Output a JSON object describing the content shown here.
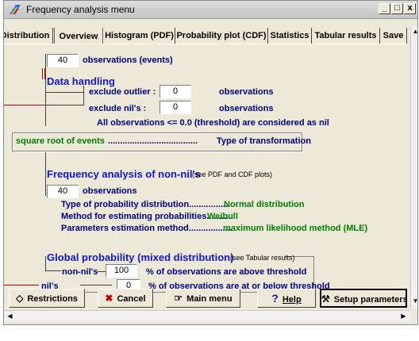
{
  "window": {
    "title": "Frequency analysis menu",
    "minimize": "_",
    "maximize": "□",
    "close": "x"
  },
  "tabs": [
    {
      "label": "Distribution"
    },
    {
      "label": "Overview",
      "active": true
    },
    {
      "label": "Histogram (PDF)"
    },
    {
      "label": "Probability plot (CDF)"
    },
    {
      "label": "Statistics"
    },
    {
      "label": "Tabular results"
    },
    {
      "label": "Save"
    }
  ],
  "overview": {
    "observations_count": "40",
    "observations_label": "observations (events)",
    "data_handling": {
      "heading": "Data handling",
      "exclude_outlier_label": "exclude outlier :",
      "exclude_outlier_value": "0",
      "exclude_outlier_unit": "observations",
      "exclude_nils_label": "exclude nil's :",
      "exclude_nils_value": "0",
      "exclude_nils_unit": "observations",
      "threshold_note": "All observations <= 0.0 (threshold) are considered as nil"
    },
    "transformation": {
      "value": "square root of events",
      "dots": ".....................................",
      "label": "Type of transformation"
    },
    "freq_non_nil": {
      "heading": "Frequency analysis of non-nil's",
      "note": "(see PDF and CDF plots)",
      "observations_value": "40",
      "observations_label": "observations",
      "distribution_label": "Type of probability distribution.................",
      "distribution_value": "Normal distribution",
      "method_label": "Method for estimating probabilities...........",
      "method_value": "Weibull",
      "estimation_label": "Parameters estimation method..................",
      "estimation_value": "maximum likelihood method (MLE)"
    },
    "global_prob": {
      "heading": "Global probability (mixed distribution)",
      "note": "(see Tabular results)",
      "non_nils_label": "non-nil's",
      "non_nils_value": "100",
      "non_nils_text": "% of observations are above threshold",
      "nils_label": "nil's",
      "nils_value": "0",
      "nils_text": "% of observations are at or below threshold"
    }
  },
  "buttons": {
    "restrictions": "Restrictions",
    "cancel": "Cancel",
    "main_menu": "Main menu",
    "help": "Help",
    "setup": "Setup parameters"
  },
  "colors": {
    "heading_blue": "#1515d0",
    "navy": "#000080",
    "green": "#008000",
    "connector_red": "#c00000"
  }
}
